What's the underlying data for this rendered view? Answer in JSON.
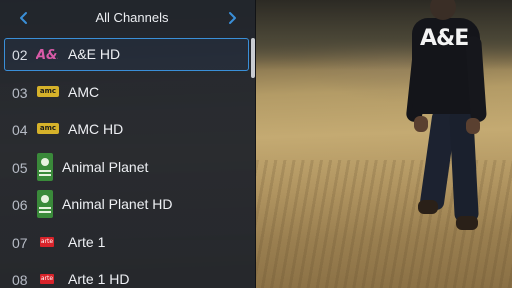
{
  "header": {
    "title": "All Channels",
    "prev_icon": "chevron-left-icon",
    "next_icon": "chevron-right-icon"
  },
  "channels": [
    {
      "number": "02",
      "name": "A&E HD",
      "logo": "ae-logo-icon",
      "selected": true
    },
    {
      "number": "03",
      "name": "AMC",
      "logo": "amc-logo-icon",
      "logo_text": "amc",
      "selected": false
    },
    {
      "number": "04",
      "name": "AMC HD",
      "logo": "amc-logo-icon",
      "logo_text": "amc",
      "selected": false
    },
    {
      "number": "05",
      "name": "Animal Planet",
      "logo": "animal-planet-logo-icon",
      "selected": false
    },
    {
      "number": "06",
      "name": "Animal Planet HD",
      "logo": "animal-planet-logo-icon",
      "selected": false
    },
    {
      "number": "07",
      "name": "Arte 1",
      "logo": "arte-logo-icon",
      "logo_text": "arte",
      "selected": false
    },
    {
      "number": "08",
      "name": "Arte 1 HD",
      "logo": "arte-logo-icon",
      "logo_text": "arte",
      "selected": false
    }
  ],
  "video": {
    "watermark": "A&E"
  },
  "colors": {
    "accent": "#3a8fd8",
    "panel_bg": "#20242c",
    "amc_logo": "#d6b22a",
    "arte_logo": "#d8232a",
    "animal_planet_logo": "#3a8a3a"
  }
}
